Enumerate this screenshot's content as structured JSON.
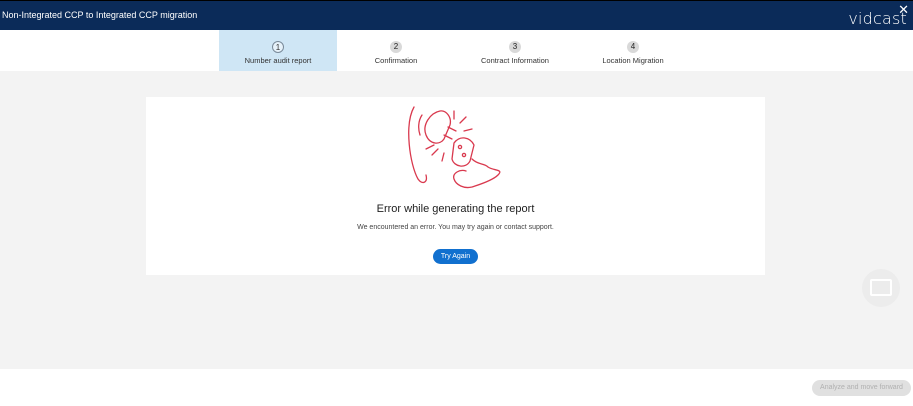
{
  "header": {
    "title": "Non-Integrated CCP to Integrated CCP migration",
    "brand": "vidcast",
    "close_glyph": "✕"
  },
  "steps": [
    {
      "number": "1",
      "label": "Number audit report",
      "active": true
    },
    {
      "number": "2",
      "label": "Confirmation",
      "active": false
    },
    {
      "number": "3",
      "label": "Contract Information",
      "active": false
    },
    {
      "number": "4",
      "label": "Location Migration",
      "active": false
    }
  ],
  "error": {
    "illustration_icon": "unplugged-cable-icon",
    "title": "Error while generating the report",
    "message": "We encountered an error. You may try again or contact support.",
    "retry_label": "Try Again",
    "illustration_color": "#d9394e"
  },
  "footer": {
    "next_label": "Analyze and move forward"
  },
  "widget": {
    "icon": "video-message-icon"
  },
  "colors": {
    "header_bg": "#0b2b59",
    "active_step_bg": "#cfe6f5",
    "primary_button": "#1170cf"
  }
}
